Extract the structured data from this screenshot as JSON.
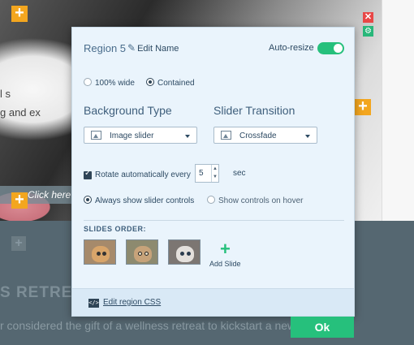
{
  "background": {
    "photo_text_1": "l s",
    "photo_text_2": "g and ex",
    "click_here": "Click here",
    "heading": "S RETREAT",
    "body_text": "r considered the gift of a wellness retreat to kickstart a new"
  },
  "dialog": {
    "title": "Region 5",
    "edit_name": "Edit Name",
    "auto_resize_label": "Auto-resize",
    "auto_resize_on": true,
    "width_options": [
      "100% wide",
      "Contained"
    ],
    "width_selected": "Contained",
    "background_type": {
      "heading": "Background Type",
      "value": "Image slider"
    },
    "slider_transition": {
      "heading": "Slider Transition",
      "value": "Crossfade"
    },
    "rotate": {
      "checked": true,
      "label": "Rotate automatically every",
      "value": "5",
      "unit": "sec"
    },
    "controls_options": [
      "Always show slider controls",
      "Show controls on hover"
    ],
    "controls_selected": "Always show slider controls",
    "slides_heading": "SLIDES ORDER:",
    "add_slide_label": "Add Slide",
    "edit_css_label": "Edit region CSS",
    "ok_label": "Ok"
  },
  "colors": {
    "accent_green": "#26c07c",
    "add_orange": "#f3a61f",
    "close_red": "#e84747",
    "dialog_bg": "#eaf4fc"
  },
  "icons": [
    "add-icon",
    "close-icon",
    "gear-icon",
    "pencil-icon",
    "image-icon",
    "chevron-down-icon",
    "code-icon",
    "plus-icon"
  ]
}
